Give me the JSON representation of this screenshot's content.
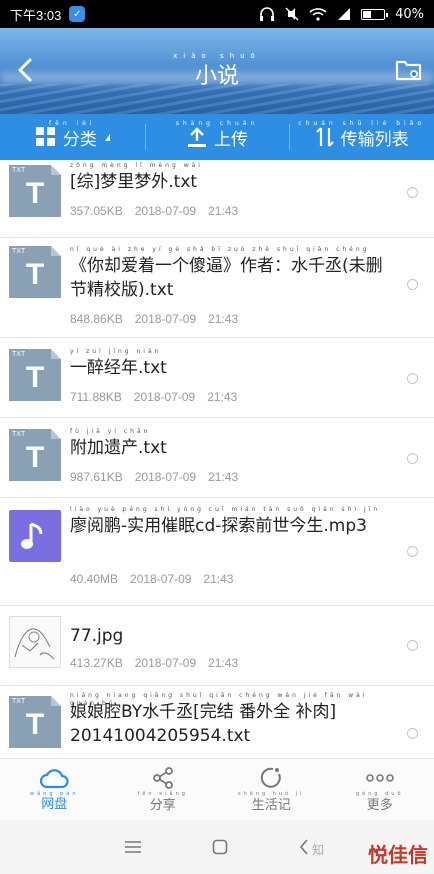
{
  "status_bar": {
    "time": "下午3:03",
    "battery": "40%",
    "battery_level": 0.4
  },
  "header": {
    "title": "小说",
    "title_pinyin": "xiǎo shuō"
  },
  "toolbar": {
    "items": [
      {
        "label": "分类",
        "pinyin": "fēn lèi"
      },
      {
        "label": "上传",
        "pinyin": "shàng chuán"
      },
      {
        "label": "传输列表",
        "pinyin": "chuán shū liè biǎo"
      }
    ]
  },
  "files": [
    {
      "type": "TXT",
      "name": "[综]梦里梦外.txt",
      "pinyin": "zōng mèng lǐ mèng wài",
      "size": "357.05KB",
      "date": "2018-07-09",
      "time": "21:43"
    },
    {
      "type": "TXT",
      "name": "《你却爱着一个傻逼》作者：水千丞(未删节精校版).txt",
      "pinyin": "nǐ què ài zhe yí gè shǎ bī zuò zhě shuǐ qiān chéng",
      "size": "848.86KB",
      "date": "2018-07-09",
      "time": "21:43"
    },
    {
      "type": "TXT",
      "name": "一醉经年.txt",
      "pinyin": "yí zuì jīng nián",
      "size": "711.88KB",
      "date": "2018-07-09",
      "time": "21:43"
    },
    {
      "type": "TXT",
      "name": "附加遗产.txt",
      "pinyin": "fù jiā yí chǎn",
      "size": "987.61KB",
      "date": "2018-07-09",
      "time": "21:43"
    },
    {
      "type": "MP3",
      "name": "廖阅鹏-实用催眠cd-探索前世今生.mp3",
      "pinyin": "liào yuè péng shí yòng cuī mián tàn suǒ qián shì jīn",
      "size": "40.40MB",
      "date": "2018-07-09",
      "time": "21:43"
    },
    {
      "type": "JPG",
      "name": "77.jpg",
      "pinyin": "",
      "size": "413.27KB",
      "date": "2018-07-09",
      "time": "21:43"
    },
    {
      "type": "TXT",
      "name": "娘娘腔BY水千丞[完结 番外全 补肉] 20141004205954.txt",
      "pinyin": "niáng niang qiāng shuǐ qiān chéng wán jié fān wài quán bǔ",
      "size": "",
      "date": "",
      "time": ""
    }
  ],
  "tabbar": {
    "items": [
      {
        "label": "网盘",
        "pinyin": "wǎng pán"
      },
      {
        "label": "分享",
        "pinyin": "fēn xiǎng"
      },
      {
        "label": "生活记",
        "pinyin": "shēng huó jì"
      },
      {
        "label": "更多",
        "pinyin": "gèng duō"
      }
    ]
  },
  "watermark": {
    "text": "悦佳信",
    "prefix": "知"
  },
  "colors": {
    "primary": "#2d8ee4",
    "txt_icon": "#8aa0b4",
    "mp3_icon": "#7a6fe0"
  }
}
